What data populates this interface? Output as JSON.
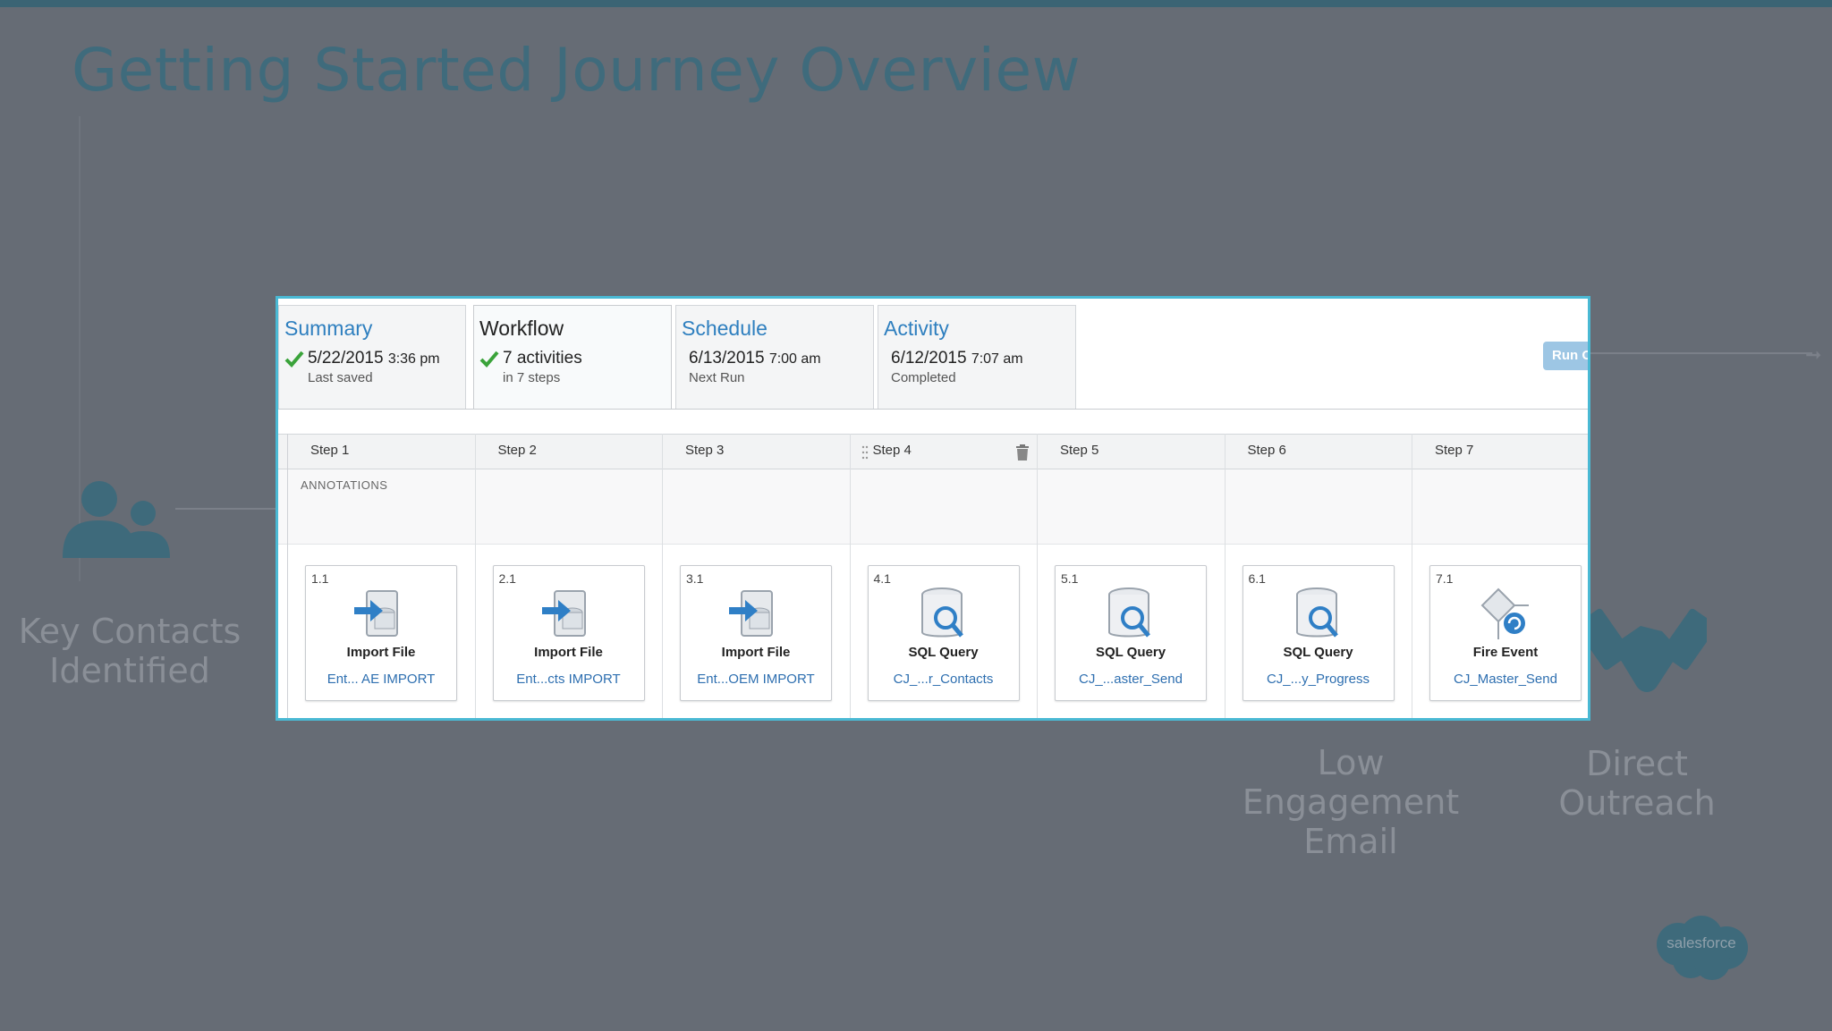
{
  "slide": {
    "title": "Getting Started Journey Overview",
    "labels": {
      "key_contacts": "Key Contacts Identified",
      "low_engagement": "Low Engagement Email",
      "direct_outreach": "Direct Outreach"
    },
    "logo_text": "salesforce"
  },
  "tabs": [
    {
      "title": "Summary",
      "main": "5/22/2015",
      "time": "3:36 pm",
      "sub": "Last saved",
      "checked": true
    },
    {
      "title": "Workflow",
      "main": "7 activities",
      "time": "",
      "sub": "in 7 steps",
      "checked": true
    },
    {
      "title": "Schedule",
      "main": "6/13/2015",
      "time": "7:00 am",
      "sub": "Next Run",
      "checked": false
    },
    {
      "title": "Activity",
      "main": "6/12/2015",
      "time": "7:07 am",
      "sub": "Completed",
      "checked": false
    }
  ],
  "run_button": "Run O",
  "annotations_label": "ANNOTATIONS",
  "steps": [
    {
      "label": "Step 1",
      "num": "1.1",
      "type": "Import File",
      "name": "Ent... AE IMPORT",
      "icon": "import-file-icon"
    },
    {
      "label": "Step 2",
      "num": "2.1",
      "type": "Import File",
      "name": "Ent...cts IMPORT",
      "icon": "import-file-icon"
    },
    {
      "label": "Step 3",
      "num": "3.1",
      "type": "Import File",
      "name": "Ent...OEM IMPORT",
      "icon": "import-file-icon"
    },
    {
      "label": "Step 4",
      "num": "4.1",
      "type": "SQL Query",
      "name": "CJ_...r_Contacts",
      "icon": "sql-query-icon"
    },
    {
      "label": "Step 5",
      "num": "5.1",
      "type": "SQL Query",
      "name": "CJ_...aster_Send",
      "icon": "sql-query-icon"
    },
    {
      "label": "Step 6",
      "num": "6.1",
      "type": "SQL Query",
      "name": "CJ_...y_Progress",
      "icon": "sql-query-icon"
    },
    {
      "label": "Step 7",
      "num": "7.1",
      "type": "Fire Event",
      "name": "CJ_Master_Send",
      "icon": "fire-event-icon"
    }
  ],
  "colors": {
    "background": "#666c75",
    "accent_border": "#4ab9d4",
    "link": "#2e6fb0",
    "title": "#3f6b7c"
  }
}
